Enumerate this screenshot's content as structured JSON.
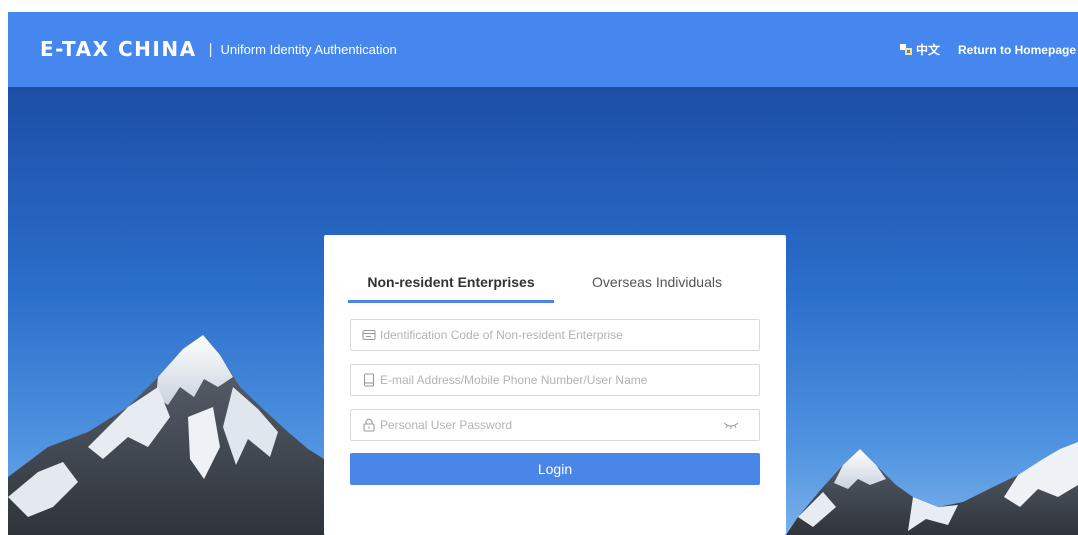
{
  "header": {
    "brand_title": "E-TAX CHINA",
    "separator": "|",
    "subtitle": "Uniform Identity Authentication",
    "language_label": "中文",
    "language_icon": "translate-icon",
    "home_link": "Return to Homepage"
  },
  "login": {
    "tabs": [
      {
        "label": "Non-resident Enterprises",
        "active": true
      },
      {
        "label": "Overseas Individuals",
        "active": false
      }
    ],
    "fields": {
      "enterprise_code": {
        "placeholder": "Identification Code of Non-resident Enterprise",
        "icon": "id-card-icon",
        "value": ""
      },
      "account": {
        "placeholder": "E-mail Address/Mobile Phone Number/User Name",
        "icon": "phone-icon",
        "value": ""
      },
      "password": {
        "placeholder": "Personal User Password",
        "icon": "lock-icon",
        "value": "",
        "toggle_icon": "eye-closed-icon"
      }
    },
    "button_label": "Login"
  },
  "colors": {
    "header": "#4587ef",
    "accent": "#4a86e8",
    "card": "#ffffff"
  }
}
